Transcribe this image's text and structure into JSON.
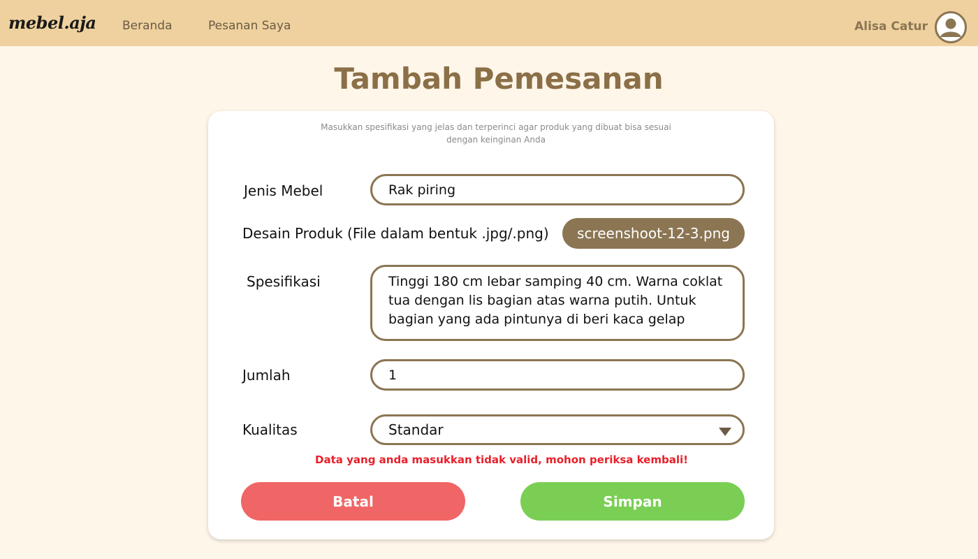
{
  "navbar": {
    "logo": "mebel.aja",
    "links": [
      "Beranda",
      "Pesanan Saya"
    ],
    "user_name": "Alisa Catur"
  },
  "page": {
    "title": "Tambah Pemesanan"
  },
  "form": {
    "subtitle": "Masukkan spesifikasi yang jelas dan terperinci agar produk yang dibuat bisa sesuai dengan keinginan Anda",
    "jenis_label": "Jenis Mebel",
    "jenis_value": "Rak piring",
    "desain_label": "Desain Produk (File dalam bentuk .jpg/.png)",
    "desain_file": "screenshoot-12-3.png",
    "spesifikasi_label": "Spesifikasi",
    "spesifikasi_value": "Tinggi 180 cm lebar samping 40 cm. Warna coklat tua dengan lis bagian atas warna putih. Untuk bagian yang ada pintunya di beri kaca gelap",
    "jumlah_label": "Jumlah",
    "jumlah_value": "1",
    "kualitas_label": "Kualitas",
    "kualitas_value": "Standar",
    "error": "Data yang anda masukkan tidak valid, mohon periksa kembali!",
    "batal_label": "Batal",
    "simpan_label": "Simpan"
  },
  "colors": {
    "navbar_bg": "#EFD19F",
    "page_bg": "#FFF6EA",
    "accent_brown": "#8B7553",
    "title_brown": "#8B6F47",
    "cancel_red": "#F06565",
    "save_green": "#7ACE54",
    "error_red": "#E8202A"
  },
  "icons": {
    "avatar": "user-circle-icon",
    "select_arrow": "caret-down-icon"
  }
}
